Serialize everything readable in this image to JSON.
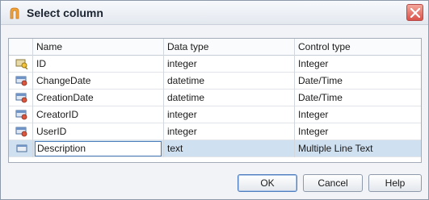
{
  "dialog": {
    "title": "Select column",
    "close_icon": "close-icon"
  },
  "grid": {
    "columns": [
      "Name",
      "Data type",
      "Control type"
    ],
    "rows": [
      {
        "name": "ID",
        "data_type": "integer",
        "control_type": "Integer",
        "icon": "key-column-icon"
      },
      {
        "name": "ChangeDate",
        "data_type": "datetime",
        "control_type": "Date/Time",
        "icon": "column-icon"
      },
      {
        "name": "CreationDate",
        "data_type": "datetime",
        "control_type": "Date/Time",
        "icon": "column-icon"
      },
      {
        "name": "CreatorID",
        "data_type": "integer",
        "control_type": "Integer",
        "icon": "column-icon"
      },
      {
        "name": "UserID",
        "data_type": "integer",
        "control_type": "Integer",
        "icon": "column-icon"
      },
      {
        "name": "Description",
        "data_type": "text",
        "control_type": "Multiple Line Text",
        "icon": "text-column-icon",
        "selected": true
      }
    ]
  },
  "buttons": {
    "ok": "OK",
    "cancel": "Cancel",
    "help": "Help"
  },
  "colors": {
    "selection": "#cfe0f1",
    "close_button": "#d9534a",
    "title_icon": "#f0a23a"
  }
}
